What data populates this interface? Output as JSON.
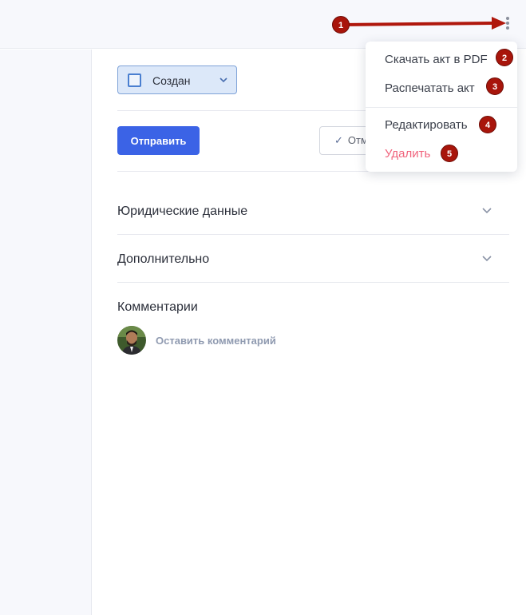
{
  "status": {
    "label": "Создан"
  },
  "actions": {
    "send_label": "Отправить",
    "sign_label": "Отм"
  },
  "sections": [
    {
      "title": "Юридические данные"
    },
    {
      "title": "Дополнительно"
    }
  ],
  "comments": {
    "title": "Комментарии",
    "placeholder": "Оставить комментарий"
  },
  "menu": {
    "items": [
      {
        "label": "Скачать акт в PDF",
        "badge": "2"
      },
      {
        "label": "Распечатать акт",
        "badge": "3"
      },
      {
        "label": "Редактировать",
        "badge": "4"
      },
      {
        "label": "Удалить",
        "badge": "5"
      }
    ]
  },
  "annotations": {
    "kebab_badge": "1"
  },
  "colors": {
    "accent": "#3b63e6",
    "danger": "#f0637c",
    "badge": "#a8150b",
    "status_bg": "#dce8f9"
  },
  "icons": [
    "more-vertical-icon",
    "chevron-down-icon",
    "checkbox-icon",
    "check-icon",
    "arrow-annotation-icon"
  ]
}
